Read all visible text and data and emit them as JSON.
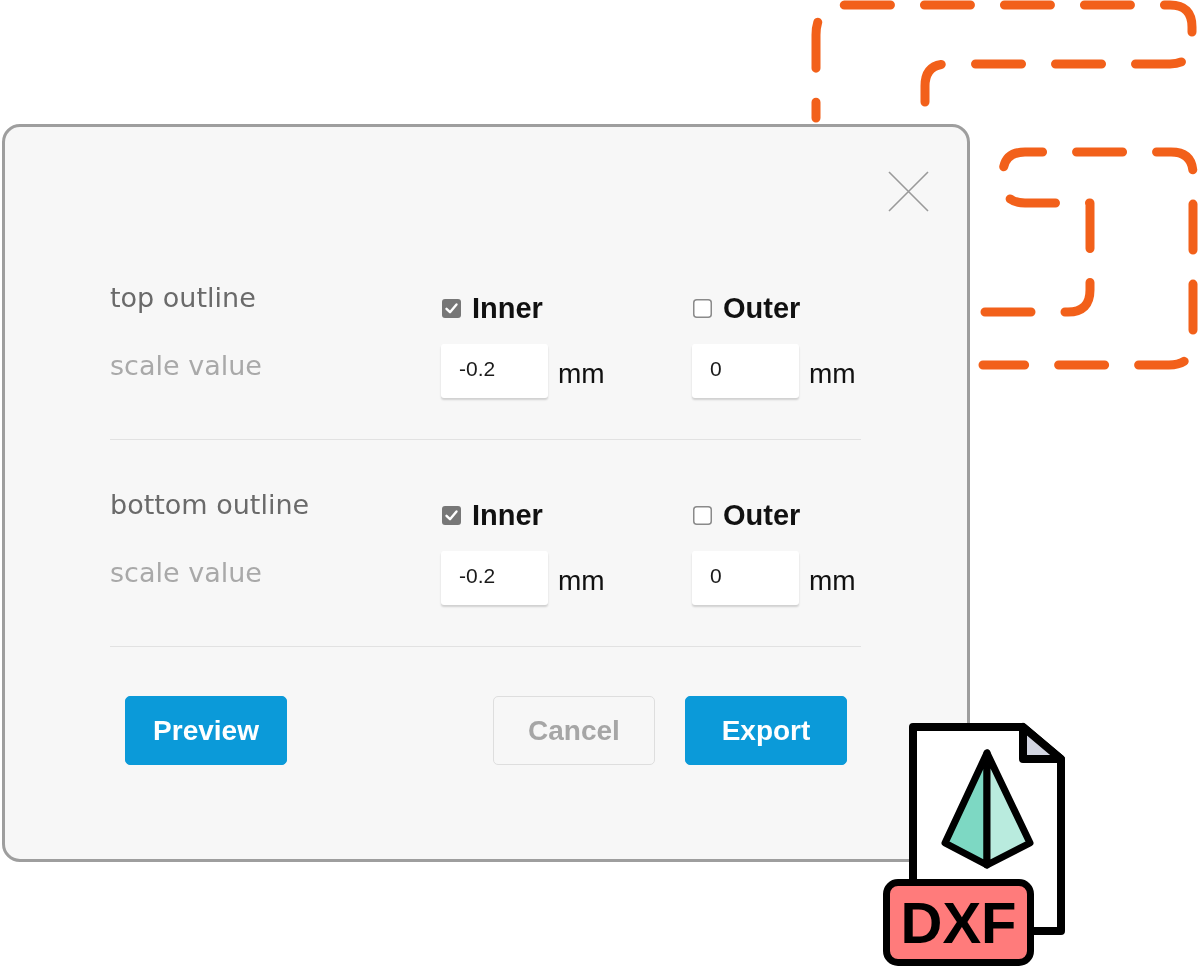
{
  "sections": [
    {
      "title": "top outline",
      "field_label": "scale value",
      "options": [
        {
          "label": "Inner",
          "checked": true,
          "value": "-0.2",
          "unit": "mm"
        },
        {
          "label": "Outer",
          "checked": false,
          "value": "0",
          "unit": "mm"
        }
      ]
    },
    {
      "title": "bottom outline",
      "field_label": "scale value",
      "options": [
        {
          "label": "Inner",
          "checked": true,
          "value": "-0.2",
          "unit": "mm"
        },
        {
          "label": "Outer",
          "checked": false,
          "value": "0",
          "unit": "mm"
        }
      ]
    }
  ],
  "footer": {
    "left_buttons": [
      {
        "label": "Preview",
        "kind": "primary"
      }
    ],
    "right_buttons": [
      {
        "label": "Cancel",
        "kind": "secondary"
      },
      {
        "label": "Export",
        "kind": "primary"
      }
    ]
  },
  "file_badge": "DXF"
}
